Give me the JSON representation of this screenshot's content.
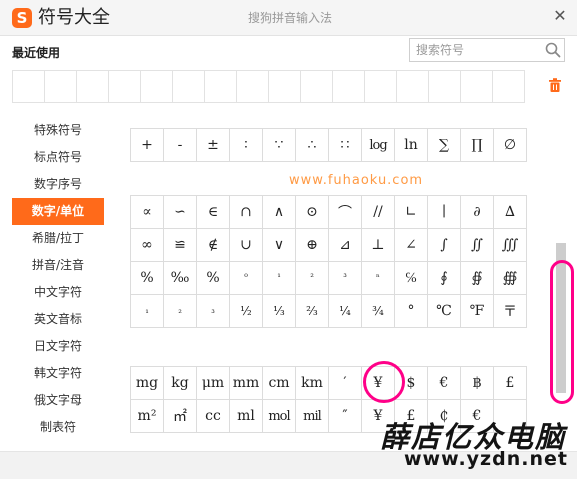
{
  "window": {
    "logo_letter": "S",
    "title": "符号大全",
    "subtitle": "搜狗拼音输入法",
    "close_glyph": "✕"
  },
  "recent": {
    "label": "最近使用"
  },
  "search": {
    "placeholder": "搜索符号",
    "value": ""
  },
  "sidebar": {
    "items": [
      {
        "label": "特殊符号"
      },
      {
        "label": "标点符号"
      },
      {
        "label": "数字序号"
      },
      {
        "label": "数字/单位"
      },
      {
        "label": "希腊/拉丁"
      },
      {
        "label": "拼音/注音"
      },
      {
        "label": "中文字符"
      },
      {
        "label": "英文音标"
      },
      {
        "label": "日文字符"
      },
      {
        "label": "韩文字符"
      },
      {
        "label": "俄文字母"
      },
      {
        "label": "制表符"
      }
    ],
    "active_label": "数字/单位"
  },
  "symbols": {
    "row_top": [
      "+",
      "-",
      "±",
      "∶",
      "∵",
      "∴",
      "∷",
      "log",
      "ln",
      "∑",
      "∏",
      "∅"
    ],
    "math_rows": [
      [
        "∝",
        "∽",
        "∈",
        "∩",
        "∧",
        "⊙",
        "⌒",
        "//",
        "∟",
        "∣",
        "∂",
        "∆"
      ],
      [
        "∞",
        "≌",
        "∉",
        "∪",
        "∨",
        "⊕",
        "⊿",
        "⊥",
        "∠",
        "∫",
        "∬",
        "∭"
      ],
      [
        "%",
        "‰",
        "%",
        "⁰",
        "¹",
        "²",
        "³",
        "ⁿ",
        "℅",
        "∮",
        "∯",
        "∰"
      ],
      [
        "₁",
        "₂",
        "₃",
        "½",
        "⅓",
        "⅔",
        "¼",
        "¾",
        "°",
        "℃",
        "℉",
        "〒"
      ]
    ],
    "unit_rows": [
      [
        "mg",
        "kg",
        "μm",
        "mm",
        "cm",
        "km",
        "′",
        "¥",
        "$",
        "€",
        "฿",
        "£"
      ],
      [
        "m²",
        "㎡",
        "cc",
        "ml",
        "mol",
        "mil",
        "″",
        "¥",
        "£",
        "₵",
        "€",
        ""
      ]
    ]
  },
  "watermarks": {
    "url": "www.fuhaoku.com",
    "brand": "薛店亿众电脑",
    "site": "www.yzdn.net"
  },
  "colors": {
    "accent": "#ff6a1a",
    "highlight": "#ff0088"
  }
}
